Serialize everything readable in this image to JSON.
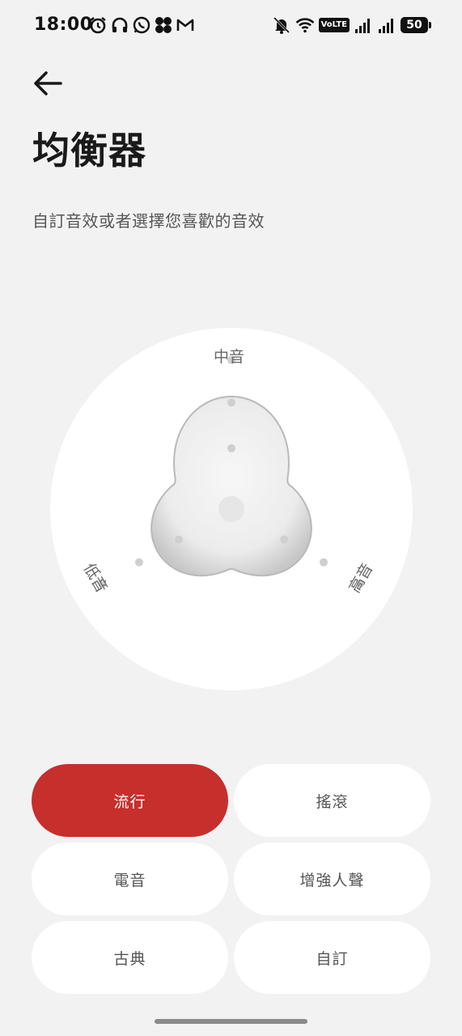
{
  "status_bar": {
    "time": "18:00",
    "left_icons": [
      "alarm-icon",
      "headphones-icon",
      "whatsapp-icon",
      "app-icon",
      "gmail-icon"
    ],
    "volte": "VoLTE",
    "battery": "50"
  },
  "header": {
    "title": "均衡器",
    "subtitle": "自訂音效或者選擇您喜歡的音效"
  },
  "equalizer": {
    "label_mid": "中音",
    "label_low": "低音",
    "label_high": "高音",
    "levels": {
      "mid": 0.74,
      "low": 0.56,
      "high": 0.56
    }
  },
  "presets": [
    {
      "label": "流行",
      "active": true
    },
    {
      "label": "搖滾",
      "active": false
    },
    {
      "label": "電音",
      "active": false
    },
    {
      "label": "增強人聲",
      "active": false
    },
    {
      "label": "古典",
      "active": false
    },
    {
      "label": "自訂",
      "active": false
    }
  ],
  "colors": {
    "accent": "#c62f2c",
    "background": "#f2f2f2",
    "card": "#ffffff"
  }
}
